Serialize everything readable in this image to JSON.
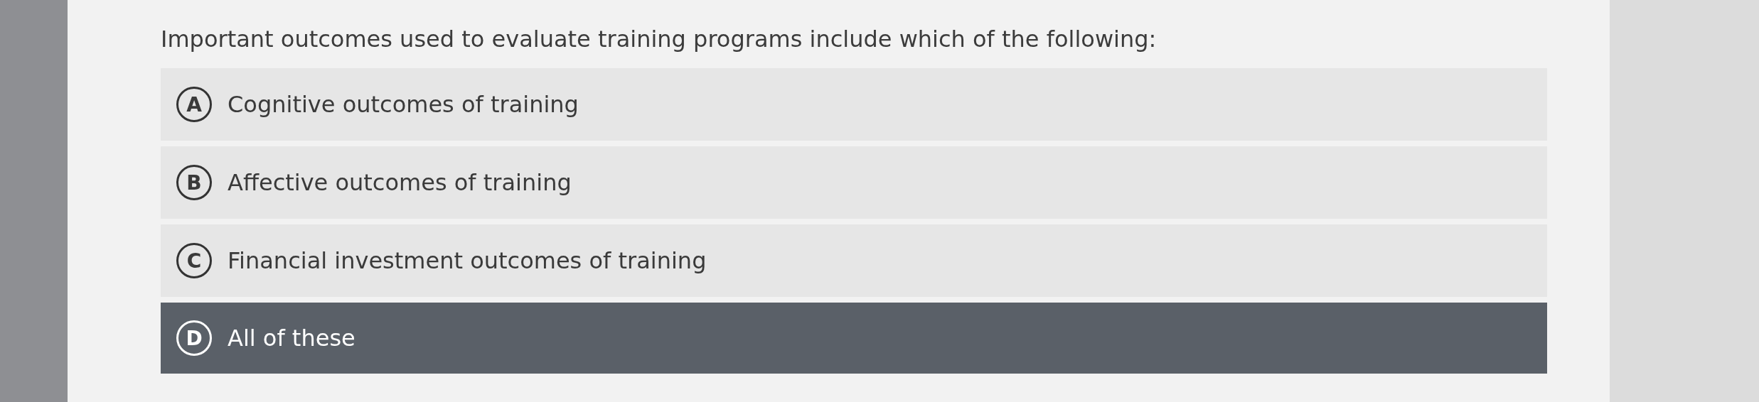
{
  "question": "Important outcomes used to evaluate training programs include which of the following:",
  "options": [
    {
      "letter": "A",
      "text": "Cognitive outcomes of training",
      "selected": false
    },
    {
      "letter": "B",
      "text": "Affective outcomes of training",
      "selected": false
    },
    {
      "letter": "C",
      "text": "Financial investment outcomes of training",
      "selected": false
    },
    {
      "letter": "D",
      "text": "All of these",
      "selected": true
    }
  ]
}
